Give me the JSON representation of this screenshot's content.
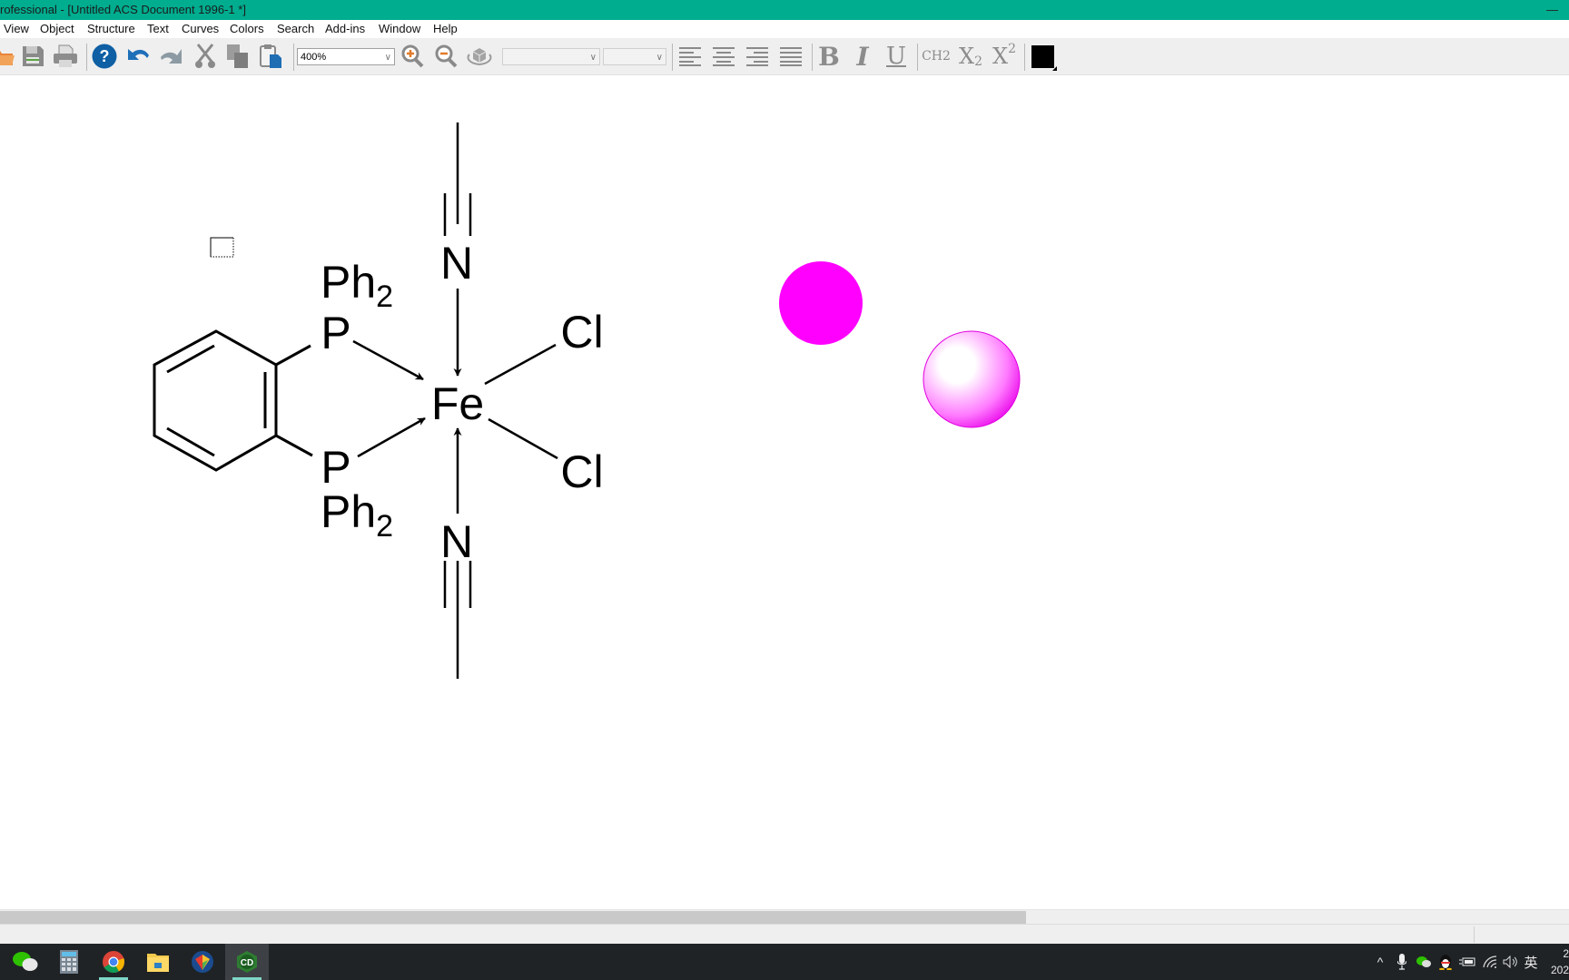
{
  "window": {
    "title": "rofessional - [Untitled ACS Document 1996-1 *]",
    "minimize_glyph": "—"
  },
  "menu": [
    "View",
    "Object",
    "Structure",
    "Text",
    "Curves",
    "Colors",
    "Search",
    "Add-ins",
    "Window",
    "Help"
  ],
  "toolbar": {
    "icons": [
      "open-icon",
      "save-icon",
      "print-icon",
      "help-icon",
      "undo-icon",
      "redo-icon",
      "cut-icon",
      "copy-icon",
      "paste-icon"
    ],
    "zoom_value": "400%",
    "zoom_in": "zoom-in-icon",
    "zoom_out": "zoom-out-icon",
    "rotate_3d": "rotate-3d-icon",
    "font_value": "",
    "size_value": "",
    "align": [
      "align-left-icon",
      "align-center-icon",
      "align-right-icon",
      "justify-icon"
    ],
    "bold": "B",
    "italic": "I",
    "underline": "U",
    "formula": "CH2",
    "subscript_base": "X",
    "subscript": "2",
    "superscript_base": "X",
    "superscript": "2",
    "color_swatch": "#000000"
  },
  "document": {
    "molecule": {
      "center": "Fe",
      "phosphine_top": "P",
      "phosphine_top_sub": "Ph",
      "phosphine_top_count": "2",
      "phosphine_bottom": "P",
      "phosphine_bottom_sub": "Ph",
      "phosphine_bottom_count": "2",
      "nitrogen_top": "N",
      "nitrogen_bottom": "N",
      "chloride_top": "Cl",
      "chloride_bottom": "Cl"
    },
    "shapes": {
      "flat_circle_color": "#ff00ff",
      "sphere_color": "#ff00ff"
    }
  },
  "taskbar": {
    "apps": [
      "wechat-icon",
      "calculator-icon",
      "chrome-icon",
      "file-explorer-icon",
      "browser-icon",
      "chemdraw-icon"
    ],
    "tray": {
      "overflow": "^",
      "ime": "英",
      "clock_time": "2",
      "clock_date": "202"
    }
  }
}
